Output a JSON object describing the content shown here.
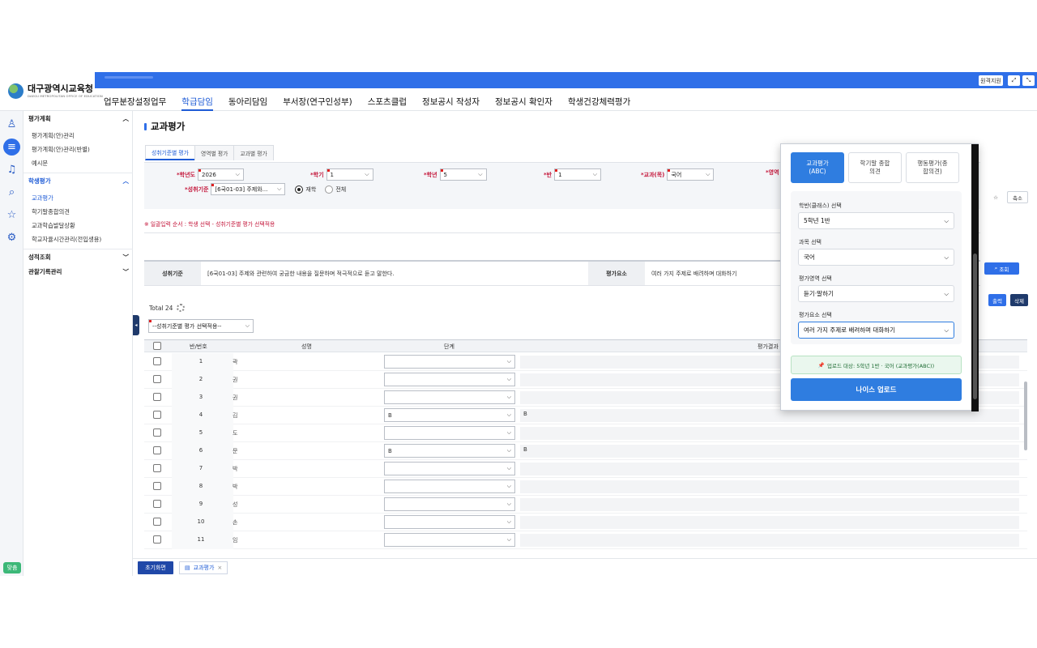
{
  "header": {
    "logo_name": "대구광역시교육청",
    "logo_sub": "DAEGU METROPOLITAN OFFICE OF EDUCATION",
    "menu": [
      "업무분장설정업무",
      "학급담임",
      "동아리담임",
      "부서장(연구인성부)",
      "스포츠클럽",
      "정보공시 작성자",
      "정보공시 확인자",
      "학생건강체력평가"
    ],
    "active_menu": "학급담임",
    "support_btn": "원격지원"
  },
  "lnb": {
    "group1": "평가계획",
    "group1_items": [
      "평가계획(안)관리",
      "평가계획(안)관리(반별)",
      "예시문"
    ],
    "group2": "학생평가",
    "group2_items": [
      "교과평가",
      "학기말종합의견",
      "교과학습발달상황",
      "학교자율시간관리(전입생용)"
    ],
    "group3": "성적조회",
    "group4": "관찰기록관리",
    "help": "맞춤"
  },
  "page": {
    "title": "교과평가",
    "tabs": [
      "성취기준별 평가",
      "영역별 평가",
      "교과별 평가"
    ],
    "collapse_btn": "축소",
    "search_btn": "조회",
    "notice": "※ 일괄입력 순서 : 학생 선택 - 성취기준별 평가 선택적용",
    "filters": {
      "year_label": "*학년도",
      "year": "2026",
      "term_label": "*학기",
      "term": "1",
      "grade_label": "*학년",
      "grade": "5",
      "class_label": "*반",
      "class": "1",
      "subject_label": "*교과(목)",
      "subject": "국어",
      "area_label": "*영역",
      "standard_label": "*성취기준",
      "standard": "[6국01-03] 주제와...",
      "radio_on": "재학",
      "radio_off": "전체"
    },
    "info": {
      "std_label": "성취기준",
      "std_text": "[6국01-03] 주제와 관련하여 궁금한 내용을 질문하며 적극적으로 듣고 말한다.",
      "elem_label": "평가요소",
      "elem_text": "여러 가지 주제로 배려하며 대화하기"
    },
    "total": "Total 24",
    "bulk_placeholder": "--성취기준별 평가 선택적용--",
    "buttons": {
      "output": "출력",
      "delete": "삭제"
    },
    "columns": {
      "no": "반/번호",
      "name": "성명",
      "level": "단계",
      "result": "평가결과"
    }
  },
  "students": [
    {
      "no": "1",
      "name": "곽",
      "level": "",
      "result": ""
    },
    {
      "no": "2",
      "name": "권",
      "level": "",
      "result": ""
    },
    {
      "no": "3",
      "name": "권",
      "level": "",
      "result": ""
    },
    {
      "no": "4",
      "name": "김",
      "level": "B",
      "result": "B"
    },
    {
      "no": "5",
      "name": "도",
      "level": "",
      "result": ""
    },
    {
      "no": "6",
      "name": "문",
      "level": "B",
      "result": "B"
    },
    {
      "no": "7",
      "name": "박",
      "level": "",
      "result": ""
    },
    {
      "no": "8",
      "name": "박",
      "level": "",
      "result": ""
    },
    {
      "no": "9",
      "name": "성",
      "level": "",
      "result": ""
    },
    {
      "no": "10",
      "name": "손",
      "level": "",
      "result": ""
    },
    {
      "no": "11",
      "name": "임",
      "level": "",
      "result": ""
    }
  ],
  "bottom": {
    "home": "초기화면",
    "doc_tab": "교과평가"
  },
  "popup": {
    "tabs": [
      "교과평가\n(ABC)",
      "학기말 종합\n의견",
      "행동평가(종\n합의견)"
    ],
    "class_label": "학반(클래스) 선택",
    "class_value": "5학년 1반",
    "subject_label": "과목 선택",
    "subject_value": "국어",
    "area_label": "평가영역 선택",
    "area_value": "듣기·말하기",
    "element_label": "평가요소 선택",
    "element_value": "여러 가지 주제로 배려하며 대화하기",
    "target": "업로드 대상: 5학년 1반 · 국어 (교과평가(ABC))",
    "upload_btn": "나이스 업로드"
  },
  "colors": {
    "primary": "#2f6fe8",
    "popup_primary": "#2f7de0",
    "required": "#c4173b"
  }
}
